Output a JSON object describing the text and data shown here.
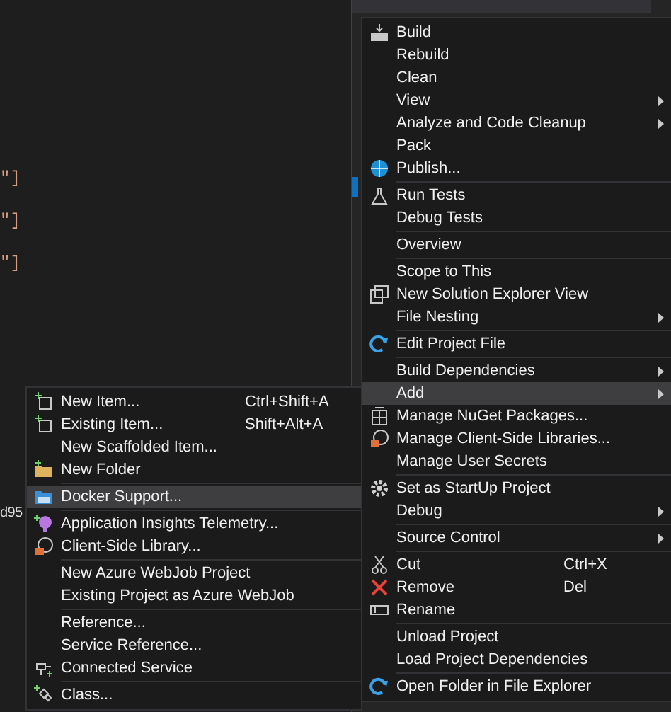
{
  "editor": {
    "lines": [
      {
        "text": "\"]"
      },
      {
        "text": "\"]"
      },
      {
        "text": "\"]"
      },
      {
        "text": "d95"
      }
    ]
  },
  "context_menu": {
    "groups": [
      [
        {
          "label": "Build",
          "arrow": false,
          "selected": false
        },
        {
          "label": "Rebuild",
          "arrow": false,
          "selected": false
        },
        {
          "label": "Clean",
          "arrow": false,
          "selected": false
        },
        {
          "label": "View",
          "arrow": true,
          "selected": false
        },
        {
          "label": "Analyze and Code Cleanup",
          "arrow": true,
          "selected": false
        },
        {
          "label": "Pack",
          "arrow": false,
          "selected": false
        },
        {
          "label": "Publish...",
          "arrow": false,
          "selected": false
        }
      ],
      [
        {
          "label": "Run Tests",
          "arrow": false,
          "selected": false
        },
        {
          "label": "Debug Tests",
          "arrow": false,
          "selected": false
        }
      ],
      [
        {
          "label": "Overview",
          "arrow": false,
          "selected": false
        }
      ],
      [
        {
          "label": "Scope to This",
          "arrow": false,
          "selected": false
        },
        {
          "label": "New Solution Explorer View",
          "arrow": false,
          "selected": false
        },
        {
          "label": "File Nesting",
          "arrow": true,
          "selected": false
        }
      ],
      [
        {
          "label": "Edit Project File",
          "arrow": false,
          "selected": false
        }
      ],
      [
        {
          "label": "Build Dependencies",
          "arrow": true,
          "selected": false
        },
        {
          "label": "Add",
          "arrow": true,
          "selected": true
        },
        {
          "label": "Manage NuGet Packages...",
          "arrow": false,
          "selected": false
        },
        {
          "label": "Manage Client-Side Libraries...",
          "arrow": false,
          "selected": false
        },
        {
          "label": "Manage User Secrets",
          "arrow": false,
          "selected": false
        }
      ],
      [
        {
          "label": "Set as StartUp Project",
          "arrow": false,
          "selected": false
        },
        {
          "label": "Debug",
          "arrow": true,
          "selected": false
        }
      ],
      [
        {
          "label": "Source Control",
          "arrow": true,
          "selected": false
        }
      ],
      [
        {
          "label": "Cut",
          "shortcut": "Ctrl+X",
          "arrow": false,
          "selected": false
        },
        {
          "label": "Remove",
          "shortcut": "Del",
          "arrow": false,
          "selected": false
        },
        {
          "label": "Rename",
          "arrow": false,
          "selected": false
        }
      ],
      [
        {
          "label": "Unload Project",
          "arrow": false,
          "selected": false
        },
        {
          "label": "Load Project Dependencies",
          "arrow": false,
          "selected": false
        }
      ],
      [
        {
          "label": "Open Folder in File Explorer",
          "arrow": false,
          "selected": false
        }
      ]
    ]
  },
  "add_submenu": {
    "groups": [
      [
        {
          "label": "New Item...",
          "shortcut": "Ctrl+Shift+A",
          "selected": false
        },
        {
          "label": "Existing Item...",
          "shortcut": "Shift+Alt+A",
          "selected": false
        },
        {
          "label": "New Scaffolded Item...",
          "selected": false
        },
        {
          "label": "New Folder",
          "selected": false
        }
      ],
      [
        {
          "label": "Docker Support...",
          "selected": true
        }
      ],
      [
        {
          "label": "Application Insights Telemetry...",
          "selected": false
        },
        {
          "label": "Client-Side Library...",
          "selected": false
        }
      ],
      [
        {
          "label": "New Azure WebJob Project",
          "selected": false
        },
        {
          "label": "Existing Project as Azure WebJob",
          "selected": false
        }
      ],
      [
        {
          "label": "Reference...",
          "selected": false
        },
        {
          "label": "Service Reference...",
          "selected": false
        },
        {
          "label": "Connected Service",
          "selected": false
        }
      ],
      [
        {
          "label": "Class...",
          "selected": false
        }
      ]
    ]
  }
}
